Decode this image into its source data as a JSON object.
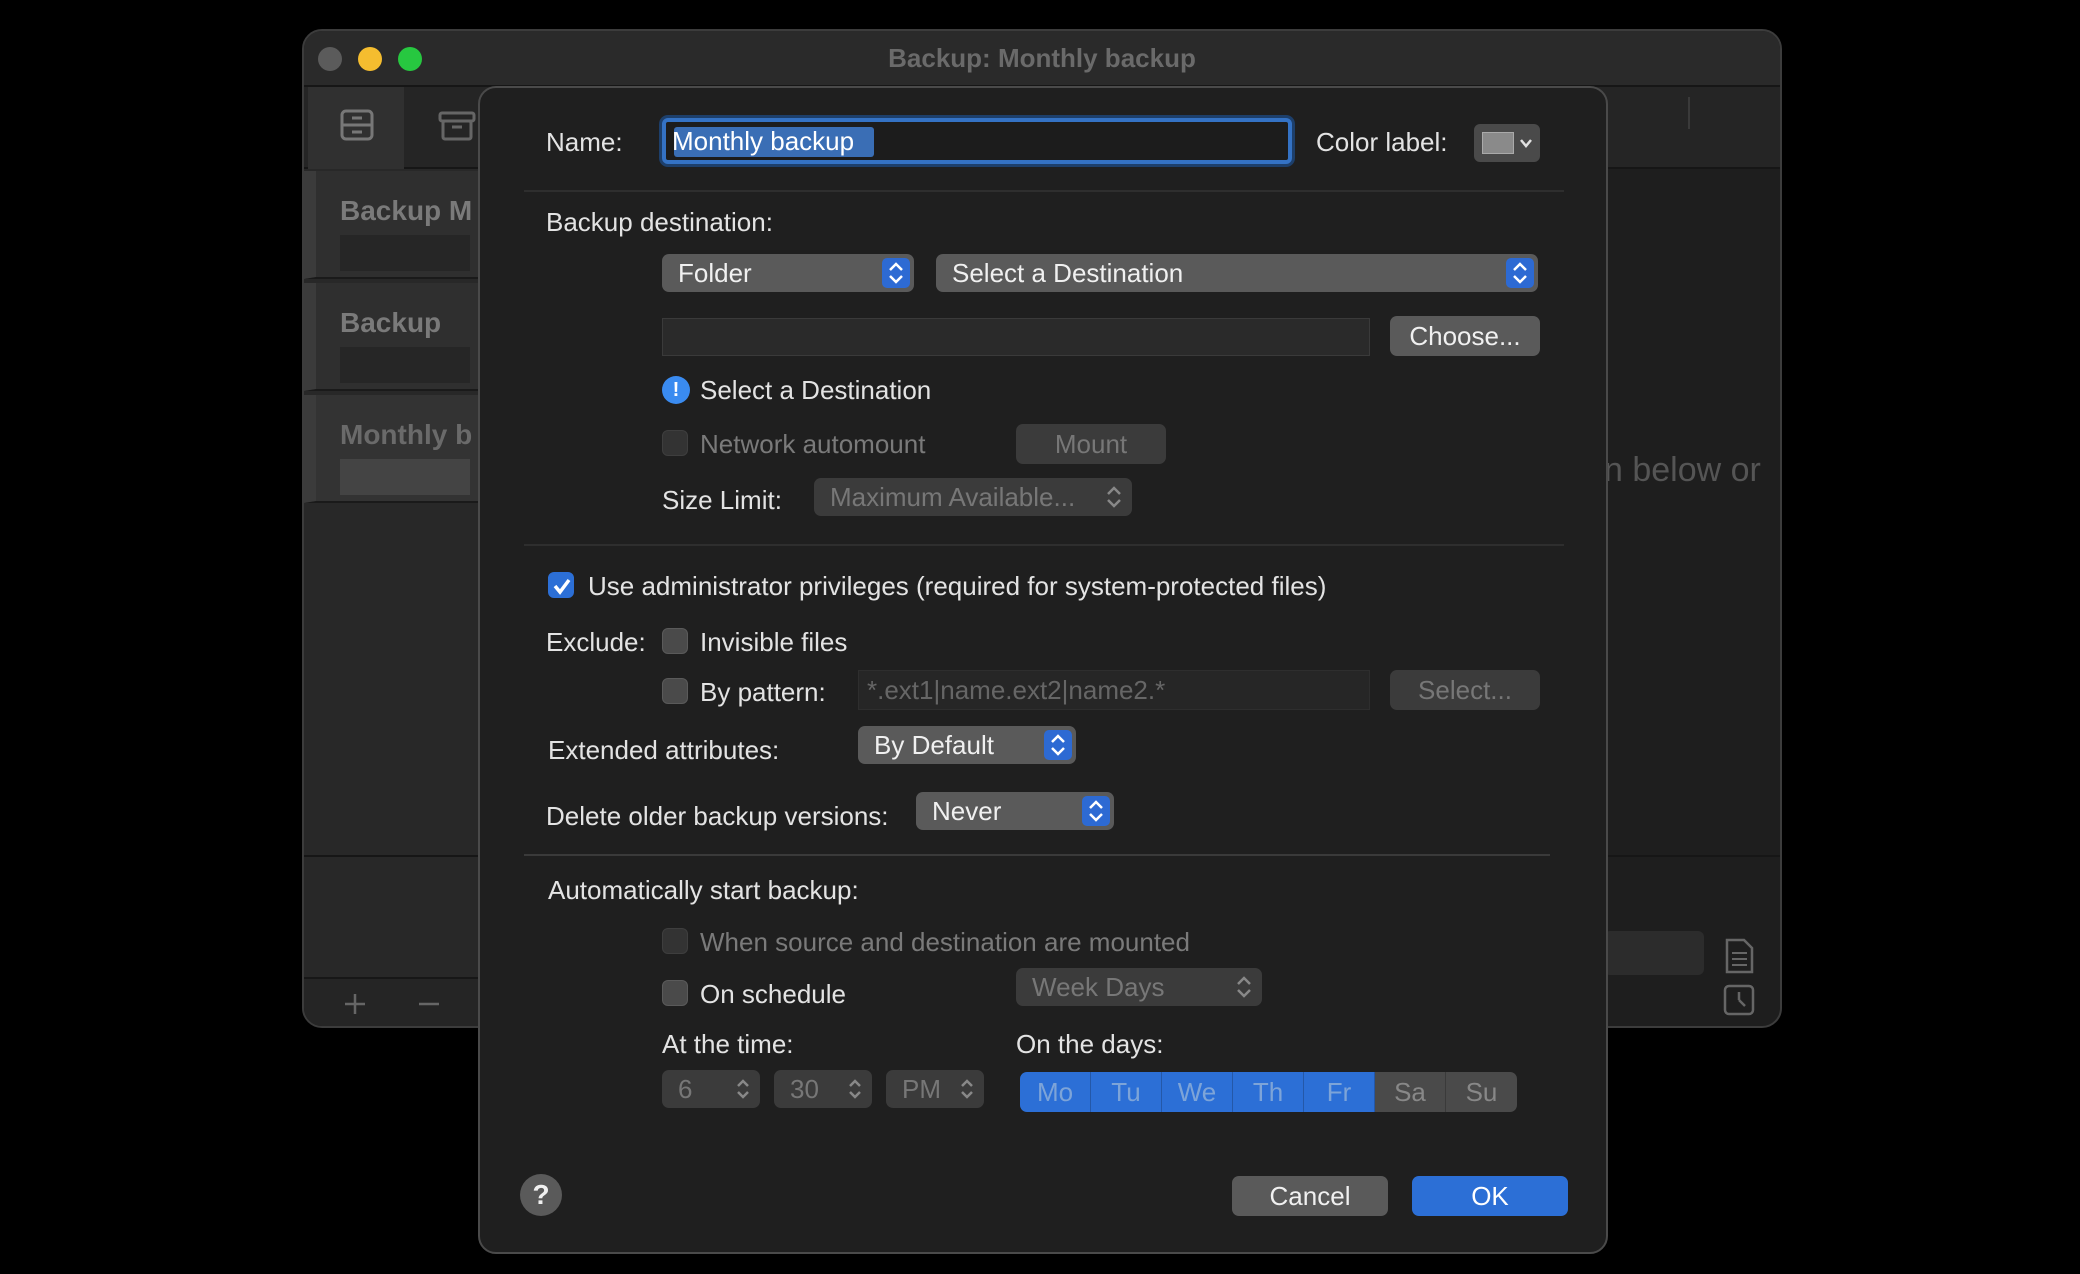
{
  "window": {
    "title": "Backup: Monthly backup",
    "sidebar_items": [
      {
        "label": "Backup M"
      },
      {
        "label": "Backup"
      },
      {
        "label": "Monthly b"
      }
    ],
    "background_hint": "n below or"
  },
  "sheet": {
    "name_label": "Name:",
    "name_value": "Monthly backup",
    "color_label": "Color label:",
    "destination": {
      "label": "Backup destination:",
      "type": "Folder",
      "target": "Select a Destination",
      "path_value": "",
      "choose_button": "Choose...",
      "warning": "Select a Destination",
      "network_automount": "Network automount",
      "mount_button": "Mount",
      "size_limit_label": "Size Limit:",
      "size_limit_value": "Maximum Available..."
    },
    "admin_privileges": "Use administrator privileges (required for system-protected files)",
    "exclude": {
      "label": "Exclude:",
      "invisible_files": "Invisible files",
      "by_pattern": "By pattern:",
      "pattern_placeholder": "*.ext1|name.ext2|name2.*",
      "select_button": "Select..."
    },
    "extended_attributes_label": "Extended attributes:",
    "extended_attributes_value": "By Default",
    "delete_older_label": "Delete older backup versions:",
    "delete_older_value": "Never",
    "auto_start": {
      "label": "Automatically start backup:",
      "when_mounted": "When source and destination are mounted",
      "on_schedule": "On schedule",
      "schedule_value": "Week Days",
      "at_time_label": "At the time:",
      "hour": "6",
      "minute": "30",
      "ampm": "PM",
      "on_days_label": "On the days:",
      "days": [
        {
          "label": "Mo",
          "selected": true
        },
        {
          "label": "Tu",
          "selected": true
        },
        {
          "label": "We",
          "selected": true
        },
        {
          "label": "Th",
          "selected": true
        },
        {
          "label": "Fr",
          "selected": true
        },
        {
          "label": "Sa",
          "selected": false
        },
        {
          "label": "Su",
          "selected": false
        }
      ]
    },
    "help_label": "?",
    "cancel_button": "Cancel",
    "ok_button": "OK"
  },
  "colors": {
    "accent": "#2c6fd6",
    "sheet_bg": "#1f1f1f",
    "window_bg": "#1e1e1e",
    "close": "#5b5b5b",
    "minimize": "#f5bd2f",
    "zoom": "#27c840"
  }
}
